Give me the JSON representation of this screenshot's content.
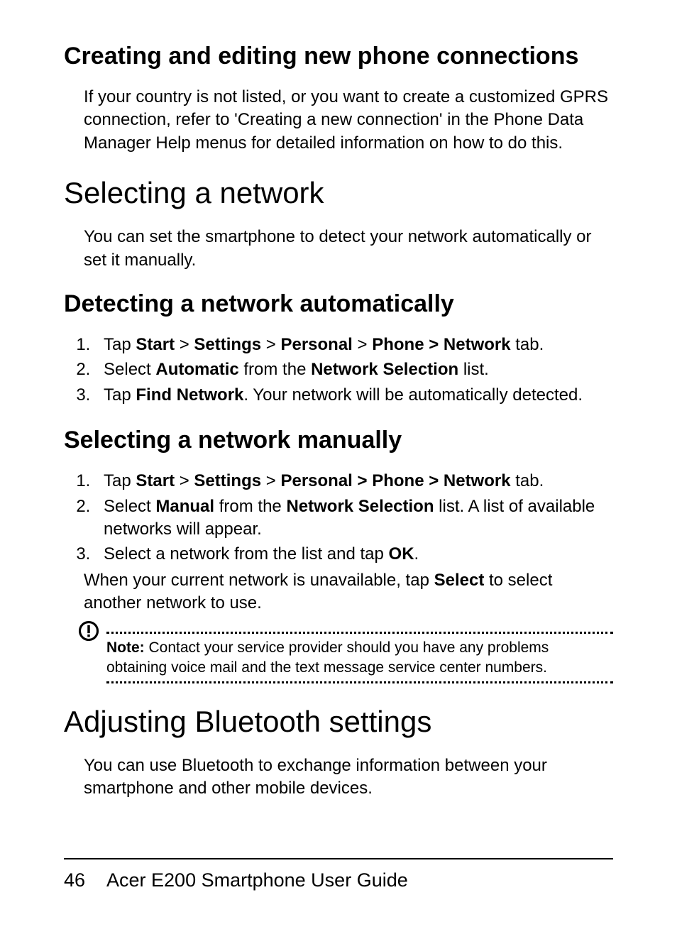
{
  "sec1": {
    "heading": "Creating and editing new phone connections",
    "para": "If your country is not listed, or you want to create a customized GPRS connection, refer to 'Creating a new connection' in the Phone Data Manager Help menus for detailed information on how to do this."
  },
  "sec2": {
    "heading": "Selecting a network",
    "para": "You can set the smartphone to detect your network automatically or set it manually."
  },
  "sec3": {
    "heading": "Detecting a network automatically",
    "step1_a": "Tap ",
    "step1_b": "Start",
    "step1_c": " > ",
    "step1_d": "Settings",
    "step1_e": " > ",
    "step1_f": "Personal",
    "step1_g": " > ",
    "step1_h": "Phone > Network",
    "step1_i": " tab.",
    "step2_a": "Select ",
    "step2_b": "Automatic",
    "step2_c": " from the ",
    "step2_d": "Network Selection",
    "step2_e": " list.",
    "step3_a": "Tap ",
    "step3_b": "Find Network",
    "step3_c": ". Your network will be automatically detected."
  },
  "sec4": {
    "heading": "Selecting a network manually",
    "step1_a": "Tap ",
    "step1_b": "Start",
    "step1_c": " > ",
    "step1_d": "Settings",
    "step1_e": " > ",
    "step1_f": "Personal > Phone > Network",
    "step1_g": " tab.",
    "step2_a": "Select ",
    "step2_b": "Manual",
    "step2_c": " from the ",
    "step2_d": "Network Selection",
    "step2_e": " list. A list of available networks will appear.",
    "step3_a": "Select a network from the list and tap ",
    "step3_b": "OK",
    "step3_c": ".",
    "after_a": "When your current network is unavailable, tap ",
    "after_b": "Select",
    "after_c": " to select another network to use."
  },
  "note": {
    "label": "Note:",
    "text": " Contact your service provider should you have any problems obtaining voice mail and the text message service center numbers."
  },
  "sec5": {
    "heading": "Adjusting Bluetooth settings",
    "para": "You can use Bluetooth to exchange information between your smartphone and other mobile devices."
  },
  "footer": {
    "page": "46",
    "title": "Acer E200 Smartphone User Guide"
  }
}
